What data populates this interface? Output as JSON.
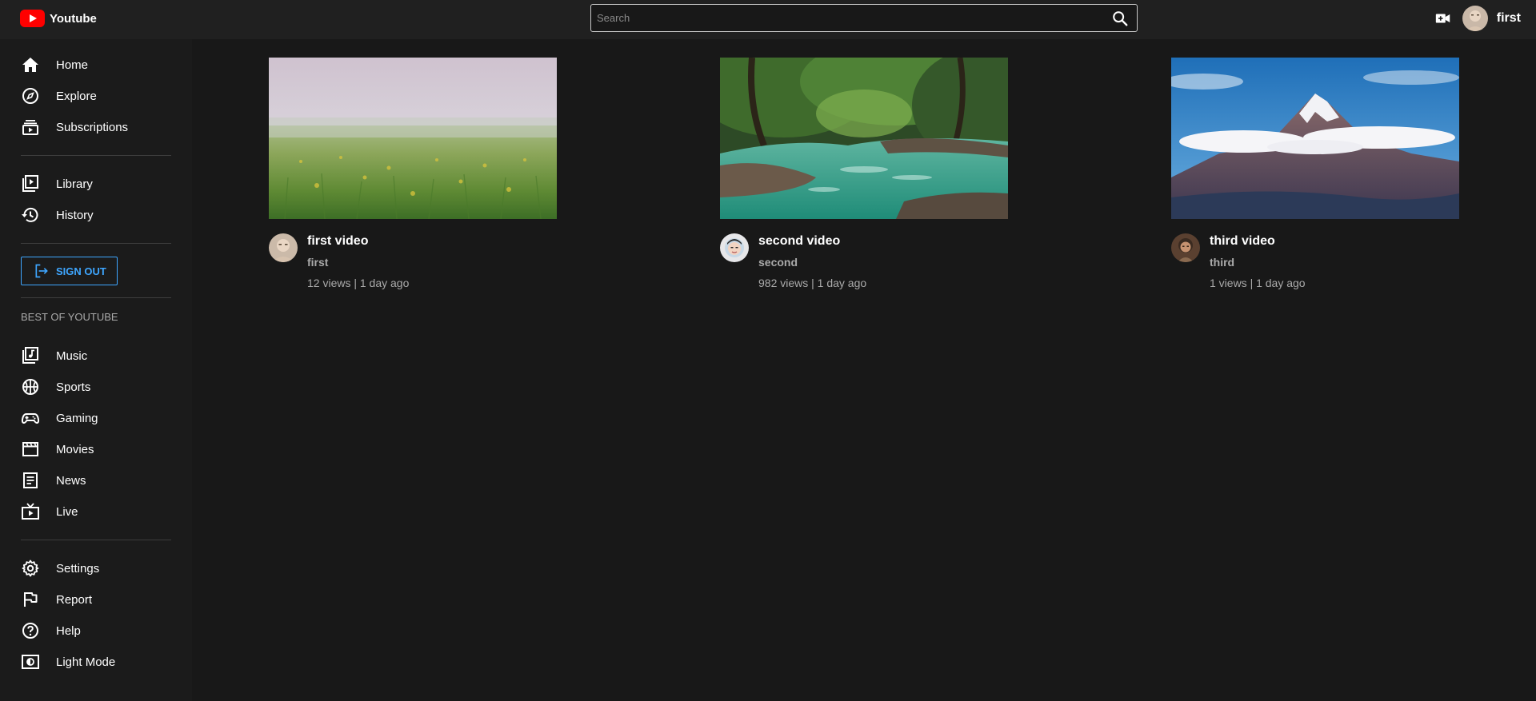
{
  "app": {
    "name": "Youtube"
  },
  "search": {
    "placeholder": "Search",
    "value": ""
  },
  "user": {
    "name": "first"
  },
  "sidebar": {
    "main_items": [
      {
        "label": "Home",
        "icon": "home-icon"
      },
      {
        "label": "Explore",
        "icon": "compass-icon"
      },
      {
        "label": "Subscriptions",
        "icon": "subscriptions-icon"
      }
    ],
    "library_items": [
      {
        "label": "Library",
        "icon": "library-icon"
      },
      {
        "label": "History",
        "icon": "history-icon"
      }
    ],
    "signout_label": "SIGN OUT",
    "best_of_title": "BEST OF YOUTUBE",
    "best_of_items": [
      {
        "label": "Music",
        "icon": "music-icon"
      },
      {
        "label": "Sports",
        "icon": "sports-icon"
      },
      {
        "label": "Gaming",
        "icon": "gaming-icon"
      },
      {
        "label": "Movies",
        "icon": "movies-icon"
      },
      {
        "label": "News",
        "icon": "news-icon"
      },
      {
        "label": "Live",
        "icon": "live-icon"
      }
    ],
    "settings_items": [
      {
        "label": "Settings",
        "icon": "gear-icon"
      },
      {
        "label": "Report",
        "icon": "flag-icon"
      },
      {
        "label": "Help",
        "icon": "help-icon"
      },
      {
        "label": "Light Mode",
        "icon": "light-mode-icon"
      }
    ]
  },
  "videos": [
    {
      "title": "first video",
      "channel": "first",
      "stats": "12 views | 1 day ago",
      "thumbnail": "meadow-thumbnail"
    },
    {
      "title": "second video",
      "channel": "second",
      "stats": "982 views | 1 day ago",
      "thumbnail": "river-thumbnail"
    },
    {
      "title": "third video",
      "channel": "third",
      "stats": "1 views | 1 day ago",
      "thumbnail": "mountain-thumbnail"
    }
  ],
  "colors": {
    "background": "#181818",
    "header": "#202020",
    "sidebar": "#1b1b1b",
    "accent": "#3ea6ff",
    "brand": "#ff0000"
  }
}
